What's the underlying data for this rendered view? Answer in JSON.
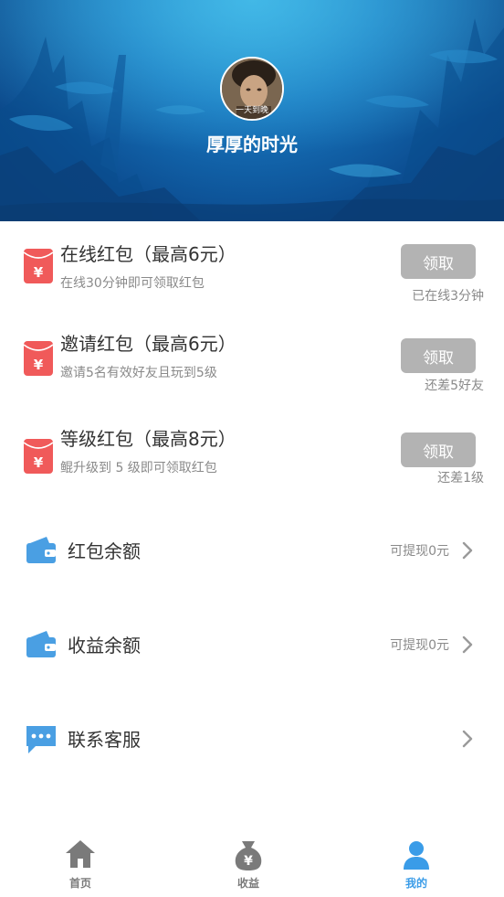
{
  "profile": {
    "username": "厚厚的时光",
    "avatar_caption": "一天到晚"
  },
  "red_packets": [
    {
      "title": "在线红包（最高6元）",
      "subtitle": "在线30分钟即可领取红包",
      "button": "领取",
      "status": "已在线3分钟"
    },
    {
      "title": "邀请红包（最高6元）",
      "subtitle": "邀请5名有效好友且玩到5级",
      "button": "领取",
      "status": "还差5好友"
    },
    {
      "title": "等级红包（最高8元）",
      "subtitle": "鲲升级到 5 级即可领取红包",
      "button": "领取",
      "status": "还差1级"
    }
  ],
  "menu": [
    {
      "label": "红包余额",
      "value": "可提现0元",
      "icon": "wallet-icon"
    },
    {
      "label": "收益余额",
      "value": "可提现0元",
      "icon": "wallet-icon"
    },
    {
      "label": "联系客服",
      "value": "",
      "icon": "chat-icon"
    }
  ],
  "tabs": [
    {
      "label": "首页",
      "icon": "home-icon",
      "active": false
    },
    {
      "label": "收益",
      "icon": "money-bag-icon",
      "active": false
    },
    {
      "label": "我的",
      "icon": "user-icon",
      "active": true
    }
  ],
  "colors": {
    "accent": "#3a9ce8",
    "red_packet": "#f05a5a",
    "wallet": "#4a9fe3",
    "button_disabled": "#b3b3b3",
    "tab_inactive": "#7a7a7a"
  }
}
